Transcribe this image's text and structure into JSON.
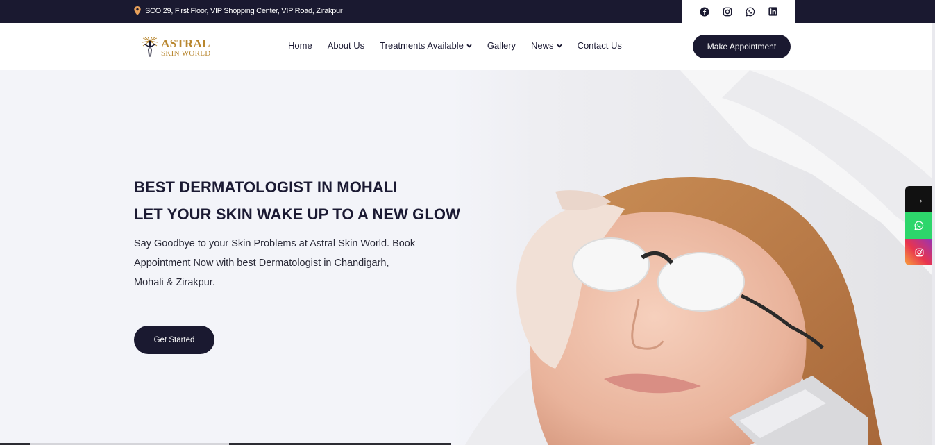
{
  "topbar": {
    "address": "SCO 29, First Floor, VIP Shopping Center, VIP Road, Zirakpur",
    "socials": [
      "facebook-icon",
      "instagram-icon",
      "whatsapp-icon",
      "linkedin-icon"
    ]
  },
  "logo": {
    "line1": "ASTRAL",
    "line2": "SKIN WORLD"
  },
  "nav": {
    "items": [
      {
        "label": "Home",
        "dropdown": false
      },
      {
        "label": "About Us",
        "dropdown": false
      },
      {
        "label": "Treatments Available",
        "dropdown": true
      },
      {
        "label": "Gallery",
        "dropdown": false
      },
      {
        "label": "News",
        "dropdown": true
      },
      {
        "label": "Contact Us",
        "dropdown": false
      }
    ],
    "appointment_label": "Make Appointment"
  },
  "hero": {
    "heading1": "BEST DERMATOLOGIST IN MOHALI",
    "heading2": "LET YOUR SKIN WAKE UP TO A NEW GLOW",
    "desc_line1": "Say Goodbye to your Skin Problems at Astral Skin World. Book",
    "desc_line2": "Appointment Now with best Dermatologist in Chandigarh,",
    "desc_line3": "Mohali & Zirakpur.",
    "cta_label": "Get Started"
  },
  "floating": {
    "arrow": "→"
  },
  "colors": {
    "dark": "#1a1930",
    "brand_gold": "#b8862e",
    "whatsapp": "#2dd66b"
  }
}
